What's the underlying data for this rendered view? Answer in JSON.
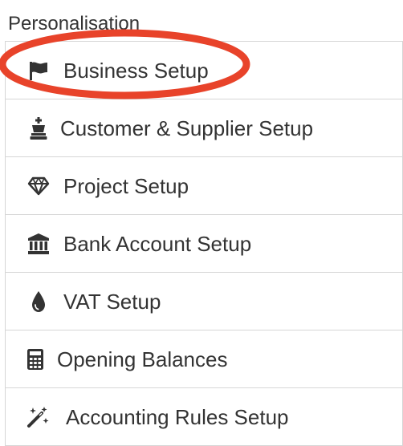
{
  "section": {
    "title": "Personalisation"
  },
  "menu": {
    "items": [
      {
        "label": "Business Setup",
        "icon": "flag-icon"
      },
      {
        "label": "Customer & Supplier Setup",
        "icon": "chess-king-icon"
      },
      {
        "label": "Project Setup",
        "icon": "gem-icon"
      },
      {
        "label": "Bank Account Setup",
        "icon": "bank-icon"
      },
      {
        "label": "VAT Setup",
        "icon": "droplet-icon"
      },
      {
        "label": "Opening Balances",
        "icon": "calculator-icon"
      },
      {
        "label": "Accounting Rules Setup",
        "icon": "magic-wand-icon"
      }
    ]
  },
  "annotation": {
    "highlight_color": "#e8432a",
    "highlighted_item": "Business Setup"
  },
  "colors": {
    "text": "#333333",
    "border": "#d6d6d6",
    "icon": "#333333"
  }
}
